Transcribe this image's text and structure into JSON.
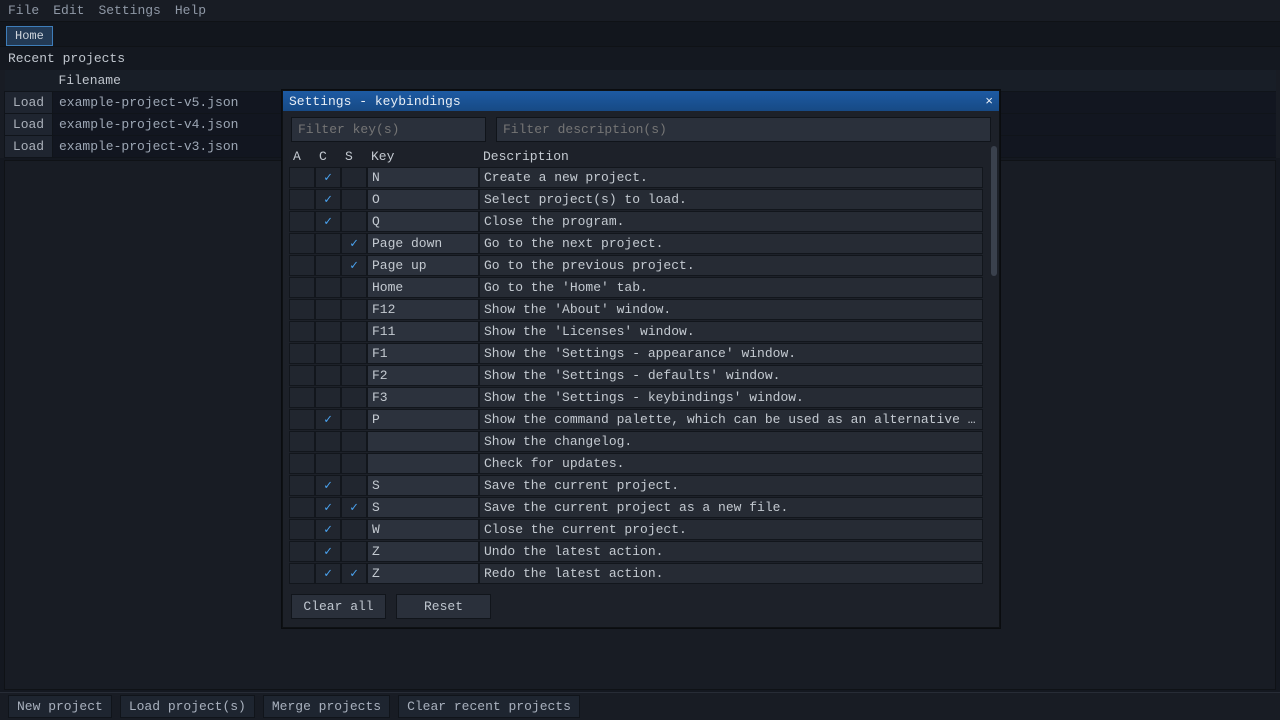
{
  "menubar": {
    "items": [
      "File",
      "Edit",
      "Settings",
      "Help"
    ]
  },
  "tabs": {
    "items": [
      "Home"
    ]
  },
  "recent": {
    "title": "Recent projects",
    "columns": [
      "",
      "Filename"
    ],
    "load_label": "Load",
    "rows": [
      "example-project-v5.json",
      "example-project-v4.json",
      "example-project-v3.json"
    ]
  },
  "footer": {
    "buttons": [
      "New project",
      "Load project(s)",
      "Merge projects",
      "Clear recent projects"
    ]
  },
  "modal": {
    "title": "Settings - keybindings",
    "filter_key_placeholder": "Filter key(s)",
    "filter_desc_placeholder": "Filter description(s)",
    "headers": {
      "a": "A",
      "c": "C",
      "s": "S",
      "key": "Key",
      "desc": "Description"
    },
    "clear_all": "Clear all",
    "reset": "Reset",
    "rows": [
      {
        "a": false,
        "c": true,
        "s": false,
        "key": "N",
        "desc": "Create a new project."
      },
      {
        "a": false,
        "c": true,
        "s": false,
        "key": "O",
        "desc": "Select project(s) to load."
      },
      {
        "a": false,
        "c": true,
        "s": false,
        "key": "Q",
        "desc": "Close the program."
      },
      {
        "a": false,
        "c": false,
        "s": true,
        "key": "Page down",
        "desc": "Go to the next project."
      },
      {
        "a": false,
        "c": false,
        "s": true,
        "key": "Page up",
        "desc": "Go to the previous project."
      },
      {
        "a": false,
        "c": false,
        "s": false,
        "key": "Home",
        "desc": "Go to the 'Home' tab."
      },
      {
        "a": false,
        "c": false,
        "s": false,
        "key": "F12",
        "desc": "Show the 'About' window."
      },
      {
        "a": false,
        "c": false,
        "s": false,
        "key": "F11",
        "desc": "Show the 'Licenses' window."
      },
      {
        "a": false,
        "c": false,
        "s": false,
        "key": "F1",
        "desc": "Show the 'Settings - appearance' window."
      },
      {
        "a": false,
        "c": false,
        "s": false,
        "key": "F2",
        "desc": "Show the 'Settings - defaults' window."
      },
      {
        "a": false,
        "c": false,
        "s": false,
        "key": "F3",
        "desc": "Show the 'Settings - keybindings' window."
      },
      {
        "a": false,
        "c": true,
        "s": false,
        "key": "P",
        "desc": "Show the command palette, which can be used as an alternative to..."
      },
      {
        "a": false,
        "c": false,
        "s": false,
        "key": "",
        "desc": "Show the changelog."
      },
      {
        "a": false,
        "c": false,
        "s": false,
        "key": "",
        "desc": "Check for updates."
      },
      {
        "a": false,
        "c": true,
        "s": false,
        "key": "S",
        "desc": "Save the current project."
      },
      {
        "a": false,
        "c": true,
        "s": true,
        "key": "S",
        "desc": "Save the current project as a new file."
      },
      {
        "a": false,
        "c": true,
        "s": false,
        "key": "W",
        "desc": "Close the current project."
      },
      {
        "a": false,
        "c": true,
        "s": false,
        "key": "Z",
        "desc": "Undo the latest action."
      },
      {
        "a": false,
        "c": true,
        "s": true,
        "key": "Z",
        "desc": "Redo the latest action."
      }
    ]
  }
}
